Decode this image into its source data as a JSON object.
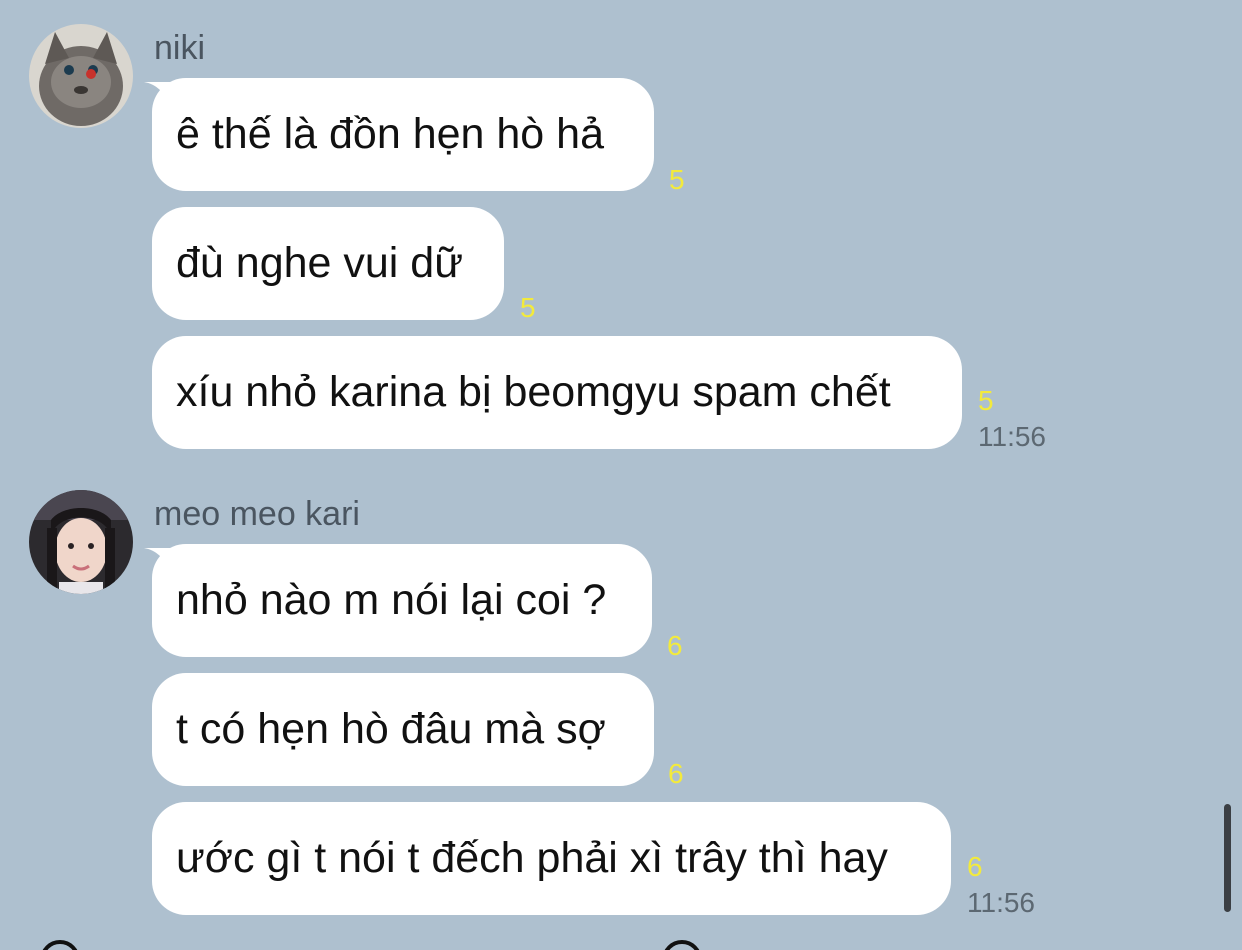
{
  "groups": [
    {
      "sender": "niki",
      "messages": [
        {
          "text": "ê thế là đồn hẹn hò hả",
          "read": "5"
        },
        {
          "text": "đù nghe vui dữ",
          "read": "5"
        },
        {
          "text": "xíu nhỏ karina bị beomgyu spam chết",
          "read": "5",
          "time": "11:56"
        }
      ]
    },
    {
      "sender": "meo meo kari",
      "messages": [
        {
          "text": "nhỏ nào m nói lại coi ?",
          "read": "6"
        },
        {
          "text": "t có hẹn hò đâu mà sợ",
          "read": "6"
        },
        {
          "text": "ước gì t nói t đếch phải xì trây thì hay",
          "read": "6",
          "time": "11:56"
        }
      ]
    }
  ],
  "colors": {
    "background": "#aec0cf",
    "bubble": "#ffffff",
    "read_count": "#f3ea3c",
    "timestamp": "#5c6872"
  }
}
